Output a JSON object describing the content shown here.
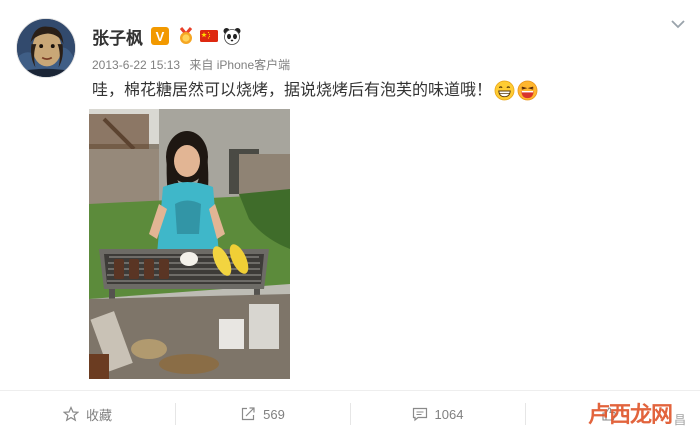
{
  "post": {
    "username": "张子枫",
    "verified_badge": "V",
    "timestamp": "2013-6-22 15:13",
    "source": "来自 iPhone客户端",
    "text": "哇，棉花糖居然可以烧烤，据说烧烤后有泡芙的味道哦！",
    "icons": [
      "avatar",
      "verified-badge-icon",
      "medal-icon",
      "china-flag-icon",
      "panda-icon",
      "grin-emoji-icon",
      "laugh-emoji-icon",
      "chevron-down-icon"
    ]
  },
  "actions": {
    "favorite_label": "收藏",
    "repost_count": "569",
    "comment_count": "1064"
  },
  "watermark": {
    "main": "卢西龙网",
    "sub": "昌"
  },
  "colors": {
    "badge": "#f29900",
    "text": "#333333",
    "meta": "#808080",
    "watermark": "#e0572d"
  }
}
